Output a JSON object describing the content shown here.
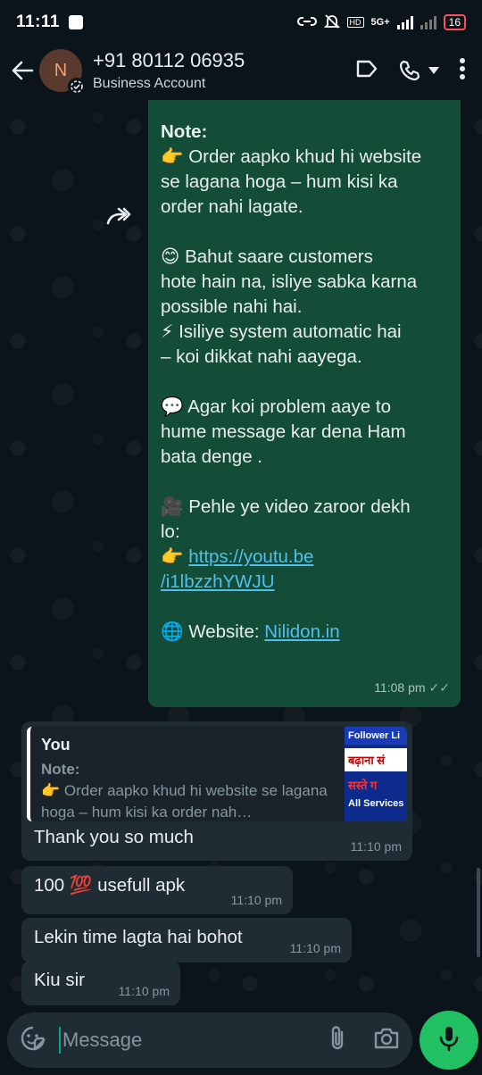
{
  "status_bar": {
    "time": "11:11",
    "network": "5G+",
    "battery": "16"
  },
  "header": {
    "avatar_letter": "N",
    "contact_name": "+91 80112 06935",
    "subtitle": "Business Account"
  },
  "outgoing_message": {
    "lines": [
      "Note:",
      "👉 Order aapko khud hi website",
      "se lagana hoga – hum kisi ka",
      "order nahi lagate.",
      "",
      "😊 Bahut saare customers",
      "hote hain na, isliye sabka karna",
      "possible nahi hai.",
      "⚡ Isiliye system automatic hai",
      "– koi dikkat nahi aayega.",
      "",
      "💬 Agar koi problem aaye to",
      "hume message kar dena Ham",
      "bata denge .",
      "",
      "🎥 Pehle ye video zaroor dekh",
      "lo:"
    ],
    "link_prefix": "👉 ",
    "link_line1": "https://youtu.be",
    "link_line2": "/i1lbzzhYWJU",
    "website_prefix": "🌐 Website: ",
    "website_link": "Nilidon.in",
    "time": "11:08 pm",
    "ticks": "✓✓"
  },
  "quoted_reply": {
    "author": "You",
    "title": "Note:",
    "text": "👉 Order aapko khud hi website se lagana hoga – hum kisi ka order nah…",
    "thumb_top": "Follower Li",
    "thumb_mid": "बढ़ाना सं",
    "thumb_red": "सस्ते ग",
    "thumb_bottom": "All Services"
  },
  "incoming_messages": [
    {
      "text": "Thank you so much",
      "time": "11:10 pm"
    },
    {
      "text": "100 💯 usefull apk",
      "time": "11:10 pm"
    },
    {
      "text": "Lekin time lagta hai bohot",
      "time": "11:10 pm"
    },
    {
      "text": "Kiu sir",
      "time": "11:10 pm"
    }
  ],
  "input": {
    "placeholder": "Message"
  },
  "colors": {
    "background": "#0b141a",
    "outgoing_bubble": "#144d37",
    "incoming_bubble": "#202c33",
    "accent_green": "#21c063",
    "link": "#53bdeb"
  }
}
